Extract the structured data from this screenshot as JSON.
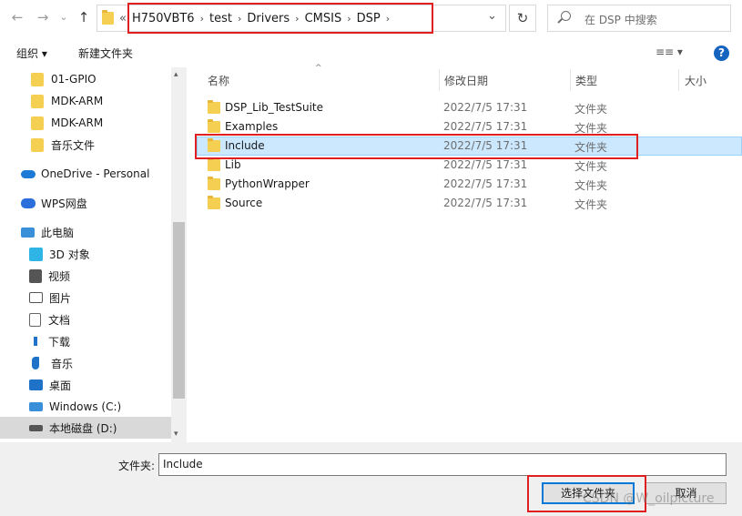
{
  "address": {
    "overflow": "«",
    "crumbs": [
      "H750VBT6",
      "test",
      "Drivers",
      "CMSIS",
      "DSP"
    ],
    "separator": "›",
    "dropdown": "⌄",
    "refresh": "↻"
  },
  "search": {
    "placeholder": "在 DSP 中搜索"
  },
  "toolbar": {
    "organize": "组织 ▾",
    "new_folder": "新建文件夹",
    "view": "≡≡ ▾",
    "help": "?"
  },
  "sidebar": {
    "items": [
      {
        "label": "01-GPIO",
        "icon": "folder-icon"
      },
      {
        "label": "MDK-ARM",
        "icon": "folder-icon"
      },
      {
        "label": "MDK-ARM",
        "icon": "folder-icon"
      },
      {
        "label": "音乐文件",
        "icon": "folder-icon"
      },
      {
        "label": "OneDrive - Personal",
        "icon": "onedrive-icon"
      },
      {
        "label": "WPS网盘",
        "icon": "wps-cloud-icon"
      },
      {
        "label": "此电脑",
        "icon": "this-pc-icon"
      },
      {
        "label": "3D 对象",
        "icon": "3d-objects-icon"
      },
      {
        "label": "视频",
        "icon": "video-icon"
      },
      {
        "label": "图片",
        "icon": "pictures-icon"
      },
      {
        "label": "文档",
        "icon": "documents-icon"
      },
      {
        "label": "下载",
        "icon": "download-icon"
      },
      {
        "label": "音乐",
        "icon": "music-icon"
      },
      {
        "label": "桌面",
        "icon": "desktop-icon"
      },
      {
        "label": "Windows (C:)",
        "icon": "drive-c-icon"
      },
      {
        "label": "本地磁盘 (D:)",
        "icon": "drive-d-icon"
      }
    ]
  },
  "columns": {
    "name": "名称",
    "date": "修改日期",
    "type": "类型",
    "size": "大小"
  },
  "files": [
    {
      "name": "DSP_Lib_TestSuite",
      "date": "2022/7/5 17:31",
      "type": "文件夹"
    },
    {
      "name": "Examples",
      "date": "2022/7/5 17:31",
      "type": "文件夹"
    },
    {
      "name": "Include",
      "date": "2022/7/5 17:31",
      "type": "文件夹"
    },
    {
      "name": "Lib",
      "date": "2022/7/5 17:31",
      "type": "文件夹"
    },
    {
      "name": "PythonWrapper",
      "date": "2022/7/5 17:31",
      "type": "文件夹"
    },
    {
      "name": "Source",
      "date": "2022/7/5 17:31",
      "type": "文件夹"
    }
  ],
  "selected_file": "Include",
  "footer": {
    "folder_label": "文件夹:",
    "folder_value": "Include",
    "select_button": "选择文件夹",
    "cancel_button": "取消"
  },
  "watermark": "CSDN @W_oilpicture",
  "colors": {
    "accent": "#0078d7",
    "selection": "#cce8ff",
    "highlight": "#e02020",
    "folder": "#f5cf52"
  }
}
